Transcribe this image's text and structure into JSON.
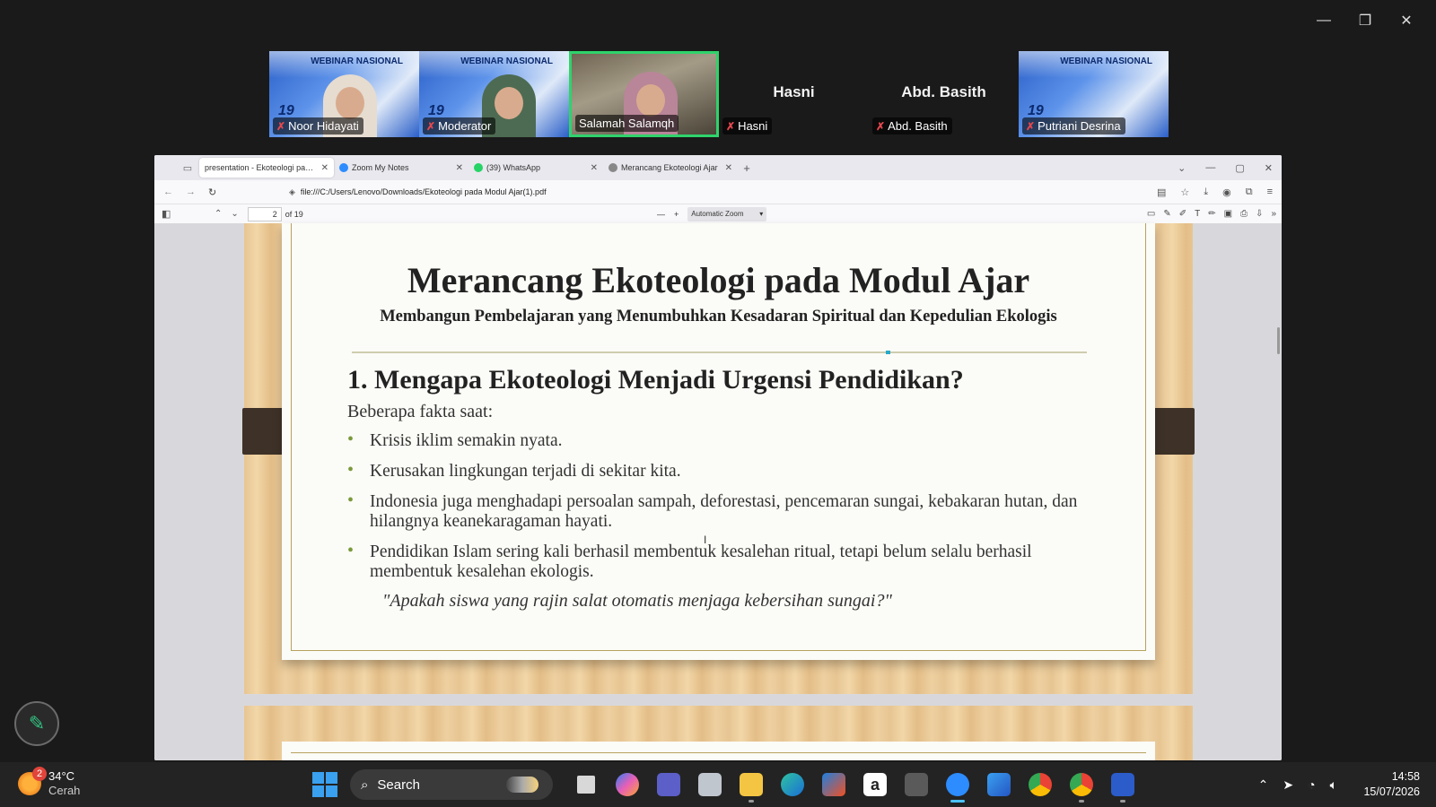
{
  "window_controls": {
    "minimize": "—",
    "restore": "❐",
    "close": "✕"
  },
  "gallery": [
    {
      "name": "Noor Hidayati",
      "type": "video",
      "badge": "WEBINAR NASIONAL",
      "number": "19"
    },
    {
      "name": "Moderator",
      "type": "video",
      "badge": "WEBINAR NASIONAL",
      "number": "19"
    },
    {
      "name": "Salamah Salamqh",
      "type": "active"
    },
    {
      "name": "Hasni",
      "type": "no-video",
      "display_name": "Hasni"
    },
    {
      "name": "Abd. Basith",
      "type": "no-video",
      "display_name": "Abd. Basith"
    },
    {
      "name": "Putriani Desrina",
      "type": "video",
      "badge": "WEBINAR NASIONAL",
      "number": "19"
    }
  ],
  "browser": {
    "tabs": [
      {
        "title": "presentation - Ekoteologi pada Mo",
        "active": true
      },
      {
        "title": "Zoom My Notes"
      },
      {
        "title": "(39) WhatsApp"
      },
      {
        "title": "Merancang Ekoteologi Ajar"
      }
    ],
    "new_tab": "+",
    "url": "file:///C:/Users/Lenovo/Downloads/Ekoteologi pada Modul Ajar(1).pdf",
    "pdf": {
      "page_number": "2",
      "page_count": "of 19",
      "zoom_minus": "—",
      "zoom_plus": "+",
      "zoom": "Automatic Zoom"
    }
  },
  "slide": {
    "title": "Merancang Ekoteologi pada Modul Ajar",
    "subtitle": "Membangun Pembelajaran yang Menumbuhkan Kesadaran Spiritual dan Kepedulian Ekologis",
    "heading": "1. Mengapa Ekoteologi Menjadi Urgensi Pendidikan?",
    "lead": "Beberapa fakta saat:",
    "bullets": [
      "Krisis iklim semakin nyata.",
      "Kerusakan lingkungan terjadi di sekitar kita.",
      "Indonesia juga menghadapi persoalan sampah, deforestasi, pencemaran sungai, kebakaran hutan, dan hilangnya keanekaragaman hayati.",
      "Pendidikan Islam sering kali berhasil membentuk kesalehan ritual, tetapi belum selalu berhasil membentuk kesalehan ekologis."
    ],
    "quote": "\"Apakah siswa yang rajin salat otomatis menjaga kebersihan sungai?\""
  },
  "taskbar": {
    "weather": {
      "temp": "34°C",
      "condition": "Cerah",
      "notifications": "2"
    },
    "search_placeholder": "Search",
    "time": "14:58",
    "date": "15/07/2026"
  },
  "colors": {
    "accent_active_speaker": "#2fd36b",
    "taskbar": "#232323",
    "bullet": "#7a9a3a"
  }
}
